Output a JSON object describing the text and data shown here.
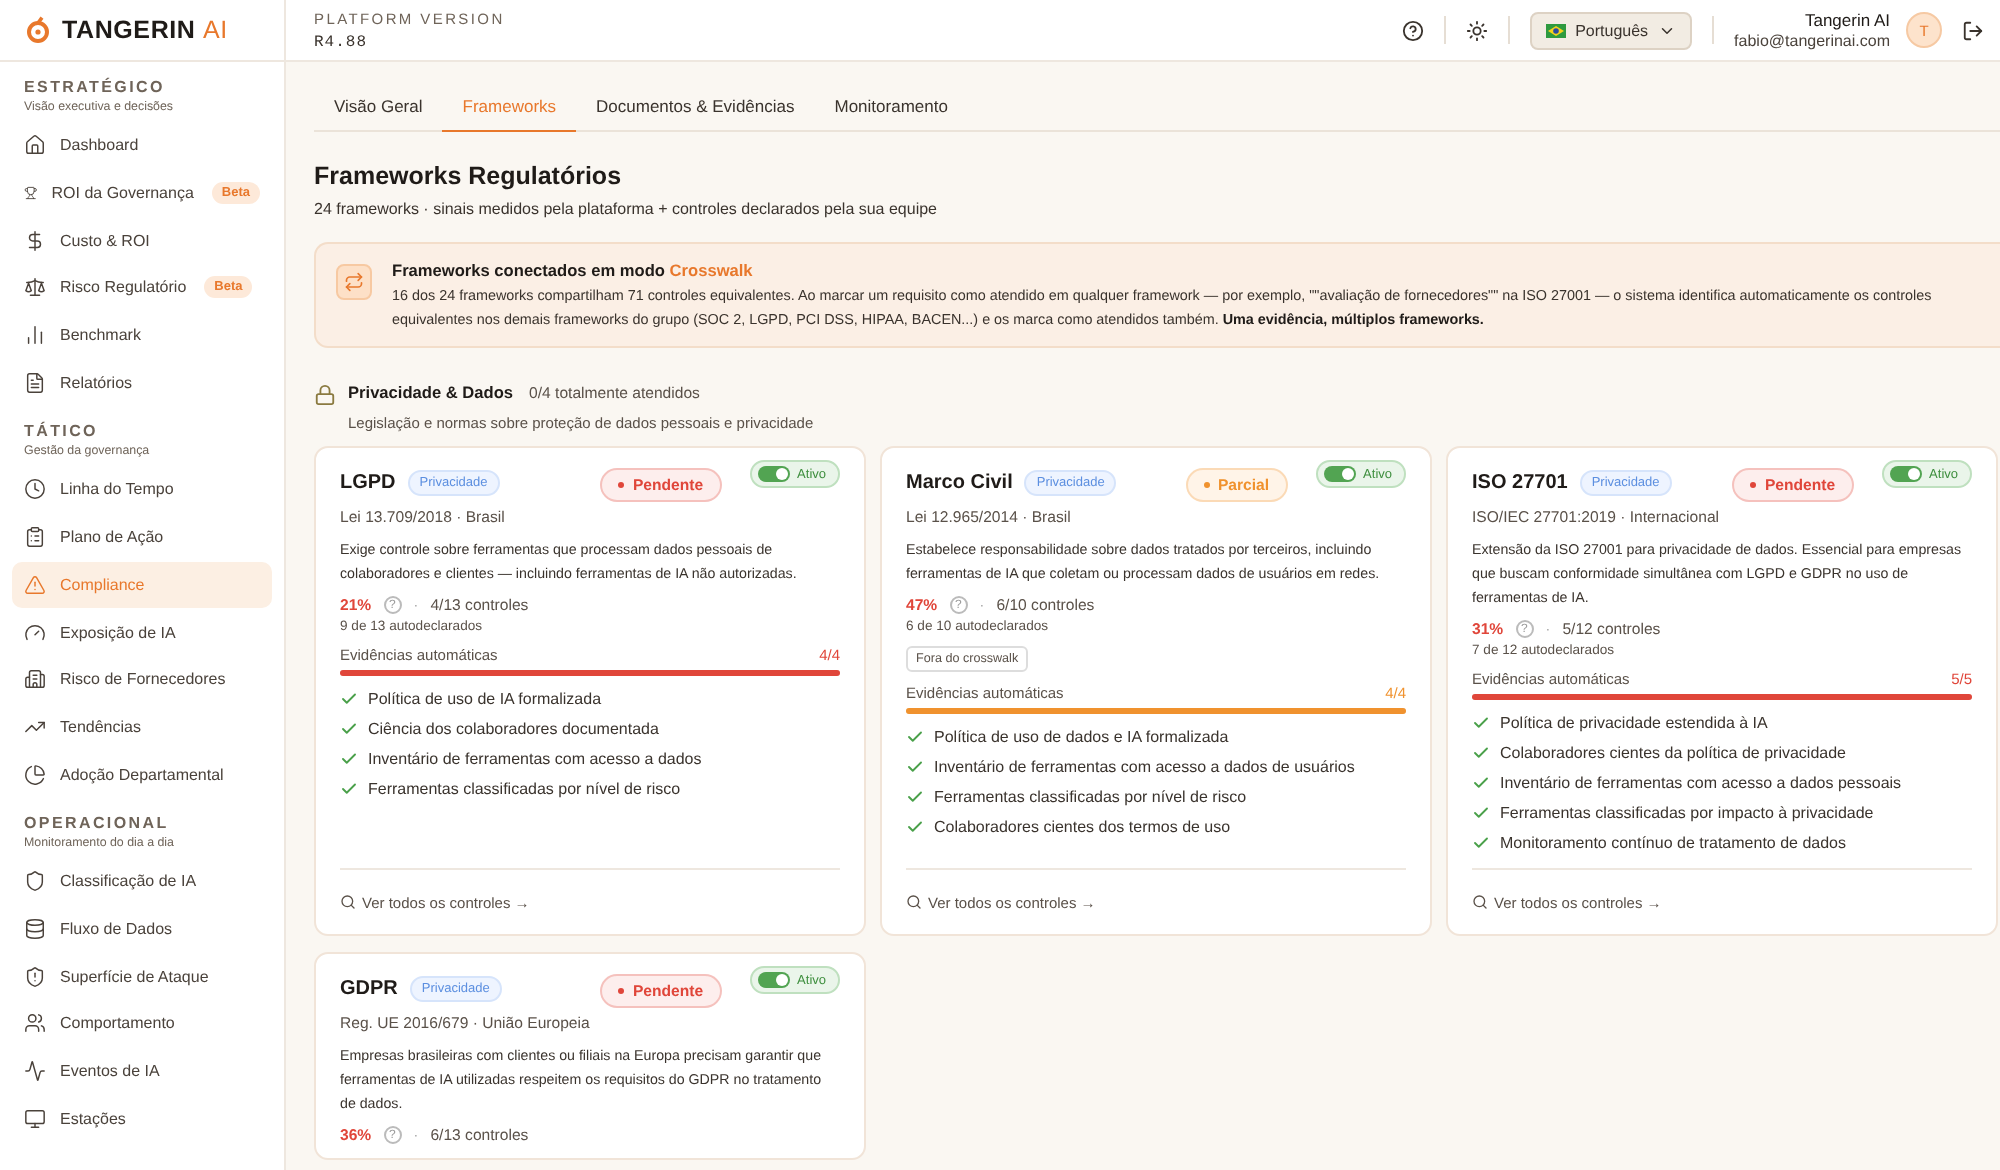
{
  "brand": {
    "name": "TANGERIN",
    "accent": "AI"
  },
  "sidebar": {
    "sections": [
      {
        "title": "ESTRATÉGICO",
        "subtitle": "Visão executiva e decisões",
        "items": [
          {
            "label": "Dashboard",
            "selected": false
          },
          {
            "label": "ROI da Governança",
            "badge": "Beta",
            "selected": false
          },
          {
            "label": "Custo & ROI",
            "selected": false
          },
          {
            "label": "Risco Regulatório",
            "badge": "Beta",
            "selected": false
          },
          {
            "label": "Benchmark",
            "selected": false
          },
          {
            "label": "Relatórios",
            "selected": false
          }
        ]
      },
      {
        "title": "TÁTICO",
        "subtitle": "Gestão da governança",
        "items": [
          {
            "label": "Linha do Tempo",
            "selected": false
          },
          {
            "label": "Plano de Ação",
            "selected": false
          },
          {
            "label": "Compliance",
            "selected": true
          },
          {
            "label": "Exposição de IA",
            "selected": false
          },
          {
            "label": "Risco de Fornecedores",
            "selected": false
          },
          {
            "label": "Tendências",
            "selected": false
          },
          {
            "label": "Adoção Departamental",
            "selected": false
          }
        ]
      },
      {
        "title": "OPERACIONAL",
        "subtitle": "Monitoramento do dia a dia",
        "items": [
          {
            "label": "Classificação de IA",
            "selected": false
          },
          {
            "label": "Fluxo de Dados",
            "selected": false
          },
          {
            "label": "Superfície de Ataque",
            "selected": false
          },
          {
            "label": "Comportamento",
            "selected": false
          },
          {
            "label": "Eventos de IA",
            "selected": false
          },
          {
            "label": "Estações",
            "selected": false
          }
        ]
      }
    ]
  },
  "header": {
    "version_label": "PLATFORM VERSION",
    "version": "R4.88",
    "language": "Português",
    "user_name": "Tangerin AI",
    "user_email": "fabio@tangerinai.com",
    "avatar": "T"
  },
  "tabs": [
    {
      "label": "Visão Geral",
      "selected": false
    },
    {
      "label": "Frameworks",
      "selected": true
    },
    {
      "label": "Documentos & Evidências",
      "selected": false
    },
    {
      "label": "Monitoramento",
      "selected": false
    }
  ],
  "page": {
    "title": "Frameworks Regulatórios",
    "subtitle": "24 frameworks · sinais medidos pela plataforma + controles declarados pela sua equipe"
  },
  "banner": {
    "title": "Frameworks conectados em modo",
    "highlight": "Crosswalk",
    "text": "16 dos 24 frameworks compartilham 71 controles equivalentes. Ao marcar um requisito como atendido em qualquer framework — por exemplo, \"\"avaliação de fornecedores\"\" na ISO 27001 — o sistema identifica automaticamente os controles equivalentes nos demais frameworks do grupo (SOC 2, LGPD, PCI DSS, HIPAA, BACEN...) e os marca como atendidos também. **Uma evidência, múltiplos frameworks.**"
  },
  "group": {
    "title": "Privacidade & Dados",
    "count": "0/4 totalmente atendidos",
    "subtitle": "Legislação e normas sobre proteção de dados pessoais e privacidade"
  },
  "cards": [
    {
      "name": "LGPD",
      "tag": "Privacidade",
      "status": {
        "kind": "pending",
        "label": "Pendente"
      },
      "active": true,
      "toggle_label": "Ativo",
      "law": "Lei 13.709/2018 · Brasil",
      "description": "Exige controle sobre ferramentas que processam dados pessoais de colaboradores e clientes — incluindo ferramentas de IA não autorizadas.",
      "percent": "21%",
      "help": "?",
      "sep": "·",
      "controls": "4/13 controles",
      "declared": "9 de 13 autodeclarados",
      "evidence_label": "Evidências automáticas",
      "evidence_count": "4/4",
      "level": 1,
      "items": [
        "Política de uso de IA formalizada",
        "Ciência dos colaboradores documentada",
        "Inventário de ferramentas com acesso a dados",
        "Ferramentas classificadas por nível de risco"
      ],
      "link": "Ver todos os controles →"
    },
    {
      "name": "Marco Civil",
      "tag": "Privacidade",
      "status": {
        "kind": "partial",
        "label": "Parcial"
      },
      "active": true,
      "toggle_label": "Ativo",
      "law": "Lei 12.965/2014 · Brasil",
      "description": "Estabelece responsabilidade sobre dados tratados por terceiros, incluindo ferramentas de IA que coletam ou processam dados de usuários em redes.",
      "percent": "47%",
      "help": "?",
      "sep": "·",
      "controls": "6/10 controles",
      "declared": "6 de 10 autodeclarados",
      "note": "Fora do crosswalk",
      "evidence_label": "Evidências automáticas",
      "evidence_count": "4/4",
      "level": 1,
      "items": [
        "Política de uso de dados e IA formalizada",
        "Inventário de ferramentas com acesso a dados de usuários",
        "Ferramentas classificadas por nível de risco",
        "Colaboradores cientes dos termos de uso"
      ],
      "link": "Ver todos os controles →"
    },
    {
      "name": "ISO 27701",
      "tag": "Privacidade",
      "status": {
        "kind": "pending",
        "label": "Pendente"
      },
      "active": true,
      "toggle_label": "Ativo",
      "law": "ISO/IEC 27701:2019 · Internacional",
      "description": "Extensão da ISO 27001 para privacidade de dados. Essencial para empresas que buscam conformidade simultânea com LGPD e GDPR no uso de ferramentas de IA.",
      "percent": "31%",
      "help": "?",
      "sep": "·",
      "controls": "5/12 controles",
      "declared": "7 de 12 autodeclarados",
      "evidence_label": "Evidências automáticas",
      "evidence_count": "5/5",
      "level": 1,
      "items": [
        "Política de privacidade estendida à IA",
        "Colaboradores cientes da política de privacidade",
        "Inventário de ferramentas com acesso a dados pessoais",
        "Ferramentas classificadas por impacto à privacidade",
        "Monitoramento contínuo de tratamento de dados"
      ],
      "link": "Ver todos os controles →"
    },
    {
      "name": "GDPR",
      "tag": "Privacidade",
      "status": {
        "kind": "pending",
        "label": "Pendente"
      },
      "active": true,
      "toggle_label": "Ativo",
      "law": "Reg. UE 2016/679 · União Europeia",
      "description": "Empresas brasileiras com clientes ou filiais na Europa precisam garantir que ferramentas de IA utilizadas respeitem os requisitos do GDPR no tratamento de dados.",
      "percent": "36%",
      "help": "?",
      "sep": "·",
      "controls": "6/13 controles"
    }
  ]
}
